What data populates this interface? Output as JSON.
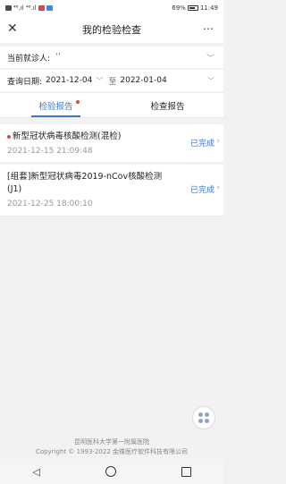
{
  "status_bar": {
    "left_text": "⁴⁶.ıl ⁴⁶.ıl",
    "right_text": "69%",
    "time": "11:49"
  },
  "header": {
    "title": "我的检验检查",
    "close_icon": "close-icon",
    "more_icon": "more-icon"
  },
  "patient": {
    "label": "当前就诊人:",
    "value": "ʼʼ"
  },
  "date_filter": {
    "label": "查询日期:",
    "start": "2021-12-04",
    "to_label": "至",
    "end": "2022-01-04"
  },
  "tabs": [
    {
      "label": "检验报告",
      "active": true,
      "has_dot": true
    },
    {
      "label": "检查报告",
      "active": false,
      "has_dot": false
    }
  ],
  "reports": [
    {
      "name": "新型冠状病毒核酸检测(混检)",
      "time": "2021-12-15 21:09:48",
      "status": "已完成",
      "unread": true
    },
    {
      "name": "[组套]新型冠状病毒2019-nCov核酸检测(J1)",
      "time": "2021-12-25 18:00:10",
      "status": "已完成",
      "unread": false
    }
  ],
  "footer": {
    "line1": "昆明医科大学第一附属医院",
    "line2": "Copyright © 1993-2022 金蝶医疗软件科技有限公司"
  },
  "colors": {
    "accent": "#3a78c8",
    "unread_dot": "#e04545",
    "background": "#f2f2f2"
  }
}
